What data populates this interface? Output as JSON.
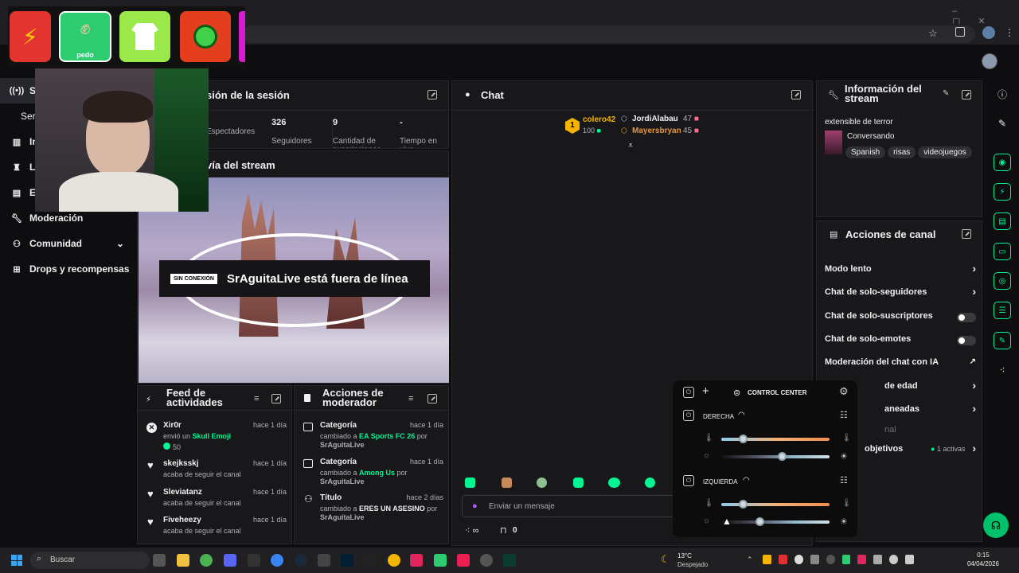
{
  "sidebar": {
    "items": [
      {
        "label": "S",
        "icon": "broadcast-icon"
      },
      {
        "label": "Ser",
        "icon": ""
      },
      {
        "label": "In",
        "icon": "chart-icon"
      },
      {
        "label": "L",
        "icon": "trophy-icon"
      },
      {
        "label": "E",
        "icon": "content-icon"
      },
      {
        "label": "Moderación",
        "icon": "wrench-icon"
      },
      {
        "label": "Comunidad",
        "icon": "people-icon"
      },
      {
        "label": "Drops y recompensas",
        "icon": "gift-icon"
      }
    ]
  },
  "overlay": {
    "emotes": [
      {
        "name": "lightning-emote",
        "color": "#e3342f"
      },
      {
        "name": "rock-hand-emote",
        "label": "pedo",
        "color": "#2ecc71"
      },
      {
        "name": "tshirt-emote",
        "color": "#9ae84a"
      },
      {
        "name": "green-circle-emote",
        "color": "#e53e1f"
      }
    ]
  },
  "session": {
    "title": "sión de la sesión",
    "stats": [
      {
        "value": "",
        "label": "Espectadores"
      },
      {
        "value": "326",
        "label": "Seguidores"
      },
      {
        "value": "9",
        "label": "Cantidad de suscripciones"
      },
      {
        "value": "-",
        "label": "Tiempo en vivo"
      }
    ]
  },
  "preview": {
    "title": "vía del stream",
    "offline_badge": "SIN CONEXIÓN",
    "offline_text": "SrAguitaLive está fuera de línea"
  },
  "chat": {
    "title": "Chat",
    "leaderboard": [
      {
        "rank": "1",
        "name": "colero42",
        "points": "100"
      },
      {
        "name": "JordiAlabau",
        "points": "47"
      },
      {
        "name": "Mayersbryan",
        "points": "45"
      }
    ],
    "input_placeholder": "Enviar un mensaje",
    "bottom_count": "0"
  },
  "stream_info": {
    "title": "Información del stream",
    "stream_title": "extensible de terror",
    "category": "Conversando",
    "tags": [
      "Spanish",
      "risas",
      "videojuegos"
    ]
  },
  "channel_actions": {
    "title": "Acciones de canal",
    "rows": [
      {
        "label": "Modo lento",
        "control": "chevron"
      },
      {
        "label": "Chat de solo-seguidores",
        "control": "chevron"
      },
      {
        "label": "Chat de solo-suscriptores",
        "control": "toggle"
      },
      {
        "label": "Chat de solo-emotes",
        "control": "toggle"
      },
      {
        "label": "Moderación del chat con IA",
        "control": "external"
      },
      {
        "label": "de edad",
        "control": "chevron"
      },
      {
        "label": "aneadas",
        "control": "chevron"
      },
      {
        "label": "nal",
        "control": "none"
      },
      {
        "label": "objetivos",
        "control": "chevron",
        "extra": "1 activas"
      }
    ]
  },
  "feed": {
    "title": "Feed de actividades",
    "items": [
      {
        "name": "Xir0r",
        "time": "hace 1 día",
        "sub_prefix": "envió un ",
        "sub_highlight": "Skull Emoji",
        "amount": "50",
        "icon": "kick-icon"
      },
      {
        "name": "skejksskj",
        "time": "hace 1 día",
        "sub": "acaba de seguir el canal",
        "icon": "heart-icon"
      },
      {
        "name": "Sleviatanz",
        "time": "hace 1 día",
        "sub": "acaba de seguir el canal",
        "icon": "heart-icon"
      },
      {
        "name": "Fiveheezy",
        "time": "hace 1 día",
        "sub": "acaba de seguir el canal",
        "icon": "heart-icon"
      }
    ]
  },
  "modactions": {
    "title": "Acciones de moderador",
    "items": [
      {
        "name": "Categoría",
        "time": "hace 1 día",
        "prefix": "cambiado a ",
        "value": "EA Sports FC 26",
        "by": "por",
        "user": "SrAguitaLive"
      },
      {
        "name": "Categoría",
        "time": "hace 1 día",
        "prefix": "cambiado a ",
        "value": "Among Us",
        "by": "por",
        "user": "SrAguitaLive"
      },
      {
        "name": "Título",
        "time": "hace 2 días",
        "prefix": "cambiado a ",
        "value": "ERES UN ASESINO",
        "by": "por",
        "user": "SrAguitaLive"
      }
    ]
  },
  "control_center": {
    "title": "CONTROL CENTER",
    "right_label": "DERECHA",
    "left_label": "IZQUIERDA",
    "right_temp": 0.2,
    "right_bright": 0.56,
    "left_temp": 0.2,
    "left_bright": 0.35
  },
  "taskbar": {
    "search_placeholder": "Buscar",
    "weather_temp": "13°C",
    "weather_desc": "Despejado",
    "time": "0:15",
    "date": "04/04/2026"
  }
}
